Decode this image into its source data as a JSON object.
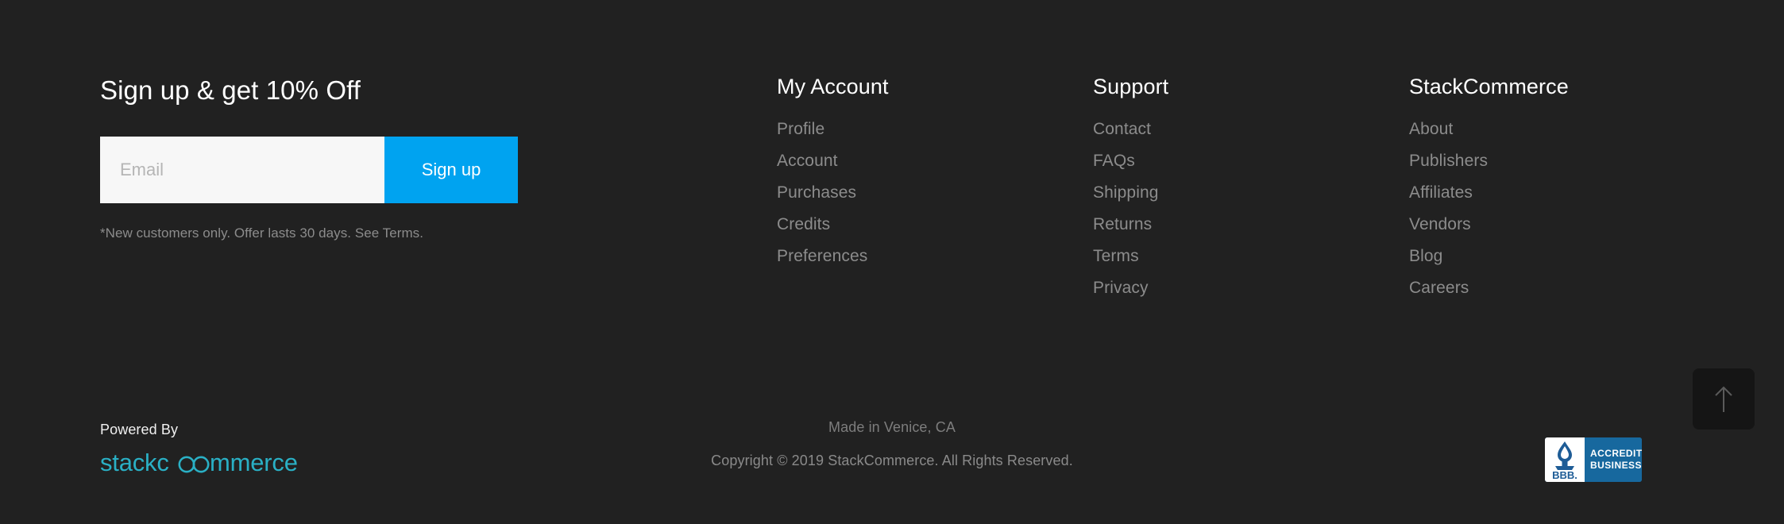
{
  "theme": {
    "background": "#212121",
    "accent_blue": "#00a3f0",
    "logo_teal": "#2ab0c5",
    "heading_color": "#ffffff",
    "link_color": "#8c8c8c"
  },
  "signup": {
    "title": "Sign up & get 10% Off",
    "email_placeholder": "Email",
    "email_value": "",
    "button_label": "Sign up",
    "note": "*New customers only. Offer lasts 30 days. See Terms."
  },
  "columns": [
    {
      "title": "My Account",
      "links": [
        "Profile",
        "Account",
        "Purchases",
        "Credits",
        "Preferences"
      ]
    },
    {
      "title": "Support",
      "links": [
        "Contact",
        "FAQs",
        "Shipping",
        "Returns",
        "Terms",
        "Privacy"
      ]
    },
    {
      "title": "StackCommerce",
      "links": [
        "About",
        "Publishers",
        "Affiliates",
        "Vendors",
        "Blog",
        "Careers"
      ]
    }
  ],
  "bottom": {
    "powered_by_label": "Powered By",
    "brand_logo_text": "stackcommerce",
    "made_in": "Made in Venice, CA",
    "copyright": "Copyright © 2019 StackCommerce. All Rights Reserved."
  },
  "bbb_badge": {
    "mark_text": "BBB",
    "line1": "ACCREDITED",
    "line2": "BUSINESS"
  },
  "scroll_top": {
    "icon": "arrow-up-icon",
    "label": "Back to top"
  }
}
